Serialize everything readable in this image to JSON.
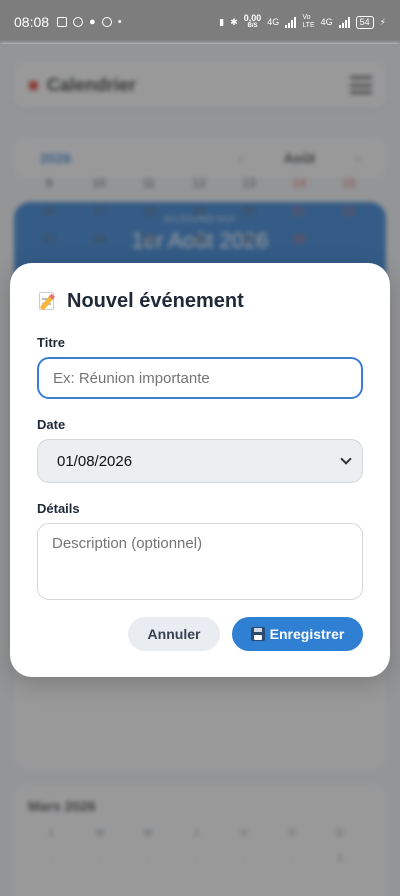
{
  "status_bar": {
    "time": "08:08",
    "data_rate": "0,00",
    "data_unit": "B/S",
    "net1": "4G",
    "net2_top": "Vo",
    "net2_bottom": "LTE",
    "net3": "4G",
    "battery": "54"
  },
  "background": {
    "app_title": "Calendrier",
    "year": "2026",
    "month": "Août",
    "hero_sub": "AUJOURD'HUI",
    "hero_date": "1er Août 2026",
    "second_month": "Mars 2026"
  },
  "modal": {
    "title": "Nouvel événement",
    "title_label": "Titre",
    "title_placeholder": "Ex: Réunion importante",
    "date_label": "Date",
    "date_value": "01/08/2026",
    "details_label": "Détails",
    "details_placeholder": "Description (optionnel)",
    "cancel_label": "Annuler",
    "save_label": "Enregistrer"
  },
  "colors": {
    "accent": "#2f7fd3",
    "focus_border": "#3a7fd5",
    "cancel_bg": "#e9edf2",
    "status_bar": "#7d7d7d"
  }
}
